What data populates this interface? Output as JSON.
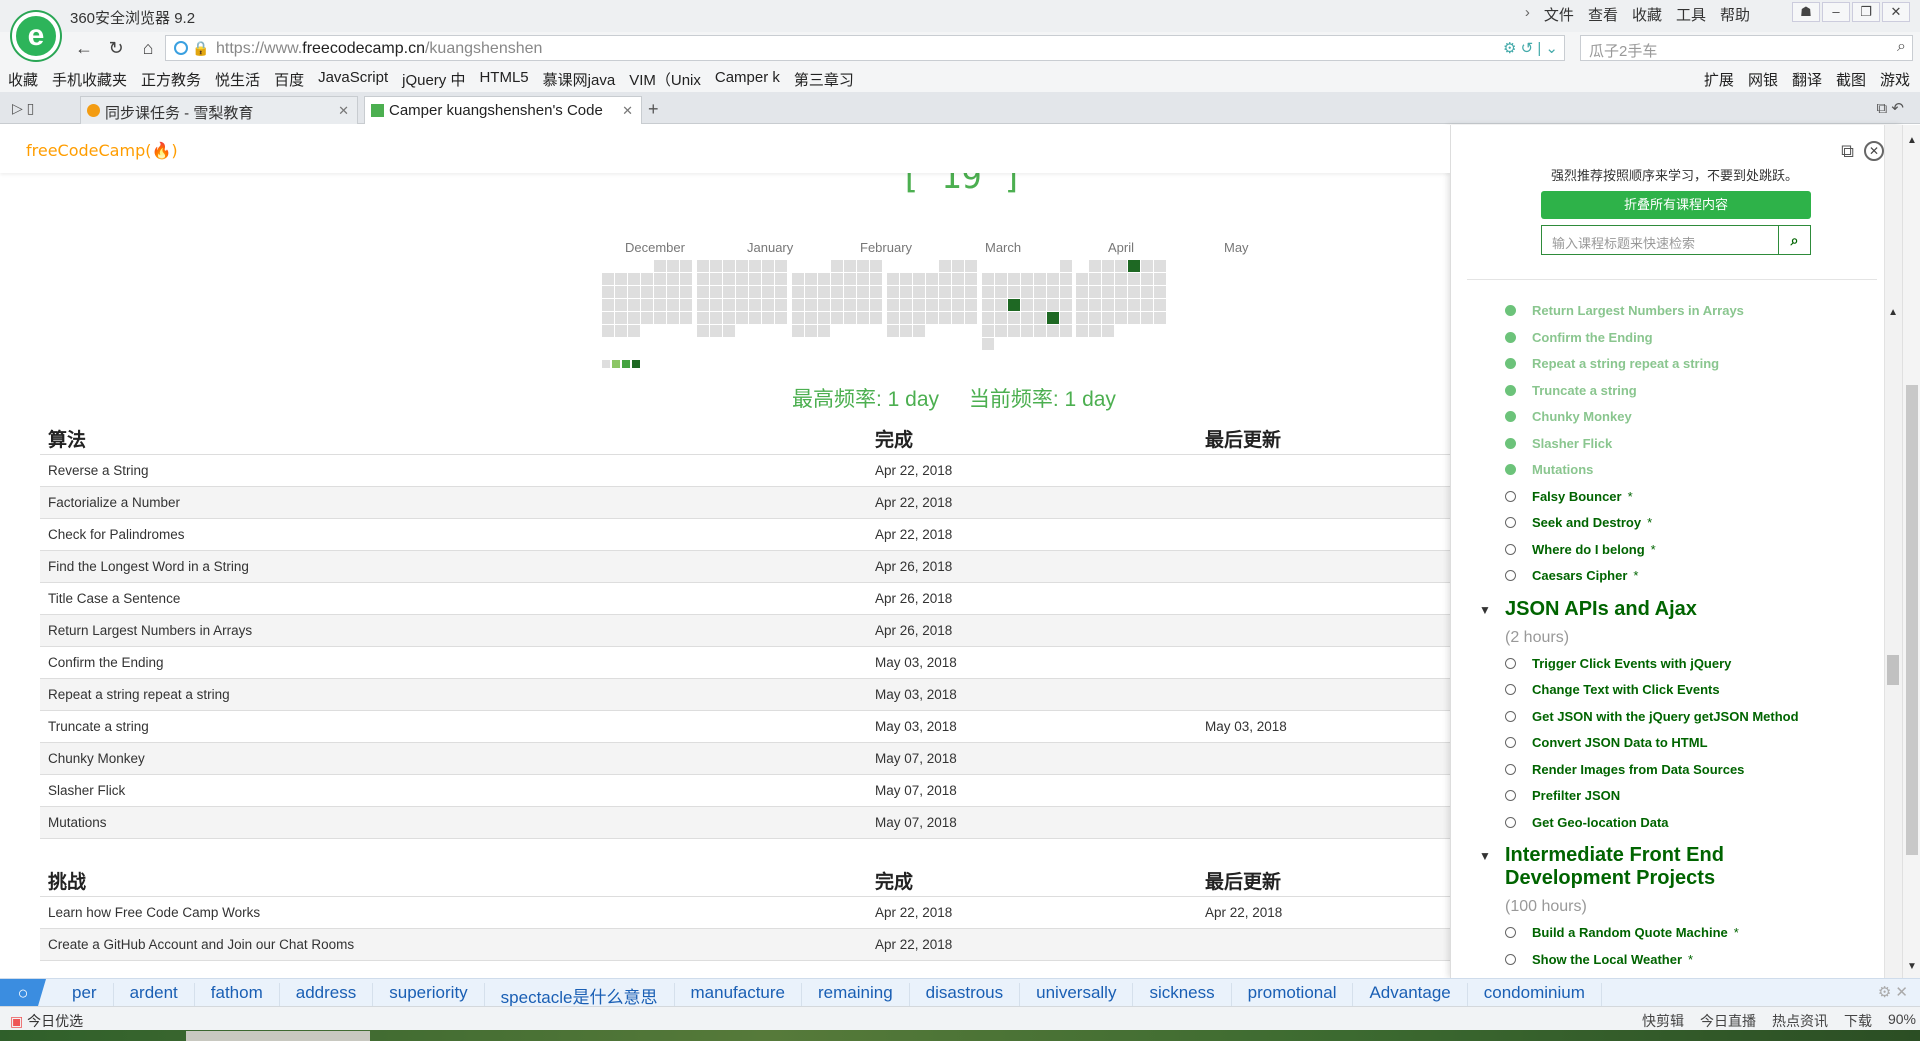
{
  "browser": {
    "app_title": "360安全浏览器 9.2",
    "menu": [
      "文件",
      "查看",
      "收藏",
      "工具",
      "帮助"
    ],
    "url_prefix": "https://www.",
    "url_domain": "freecodecamp.cn",
    "url_path": "/kuangshenshen",
    "search_placeholder": "瓜子2手车",
    "bookmarks": [
      "收藏",
      "手机收藏夹",
      "正方教务",
      "悦生活",
      "百度",
      "JavaScript",
      "jQuery 中",
      "HTML5",
      "慕课网java",
      "VIM（Unix",
      "Camper k",
      "第三章习"
    ],
    "bookmarks_right": [
      "扩展",
      "网银",
      "翻译",
      "截图",
      "游戏"
    ],
    "tabs": [
      {
        "label": "同步课任务 - 雪梨教育"
      },
      {
        "label": "Camper kuangshenshen's Code"
      }
    ]
  },
  "page": {
    "logo": "freeCodeCamp(🔥)",
    "streak_count": "[ 19 ]",
    "months": [
      "December",
      "January",
      "February",
      "March",
      "April",
      "May"
    ],
    "longest_streak": "最高频率: 1 day",
    "current_streak": "当前频率: 1 day",
    "algorithms": {
      "headers": [
        "算法",
        "完成",
        "最后更新"
      ],
      "rows": [
        [
          "Reverse a String",
          "Apr 22, 2018",
          ""
        ],
        [
          "Factorialize a Number",
          "Apr 22, 2018",
          ""
        ],
        [
          "Check for Palindromes",
          "Apr 22, 2018",
          ""
        ],
        [
          "Find the Longest Word in a String",
          "Apr 26, 2018",
          ""
        ],
        [
          "Title Case a Sentence",
          "Apr 26, 2018",
          ""
        ],
        [
          "Return Largest Numbers in Arrays",
          "Apr 26, 2018",
          ""
        ],
        [
          "Confirm the Ending",
          "May 03, 2018",
          ""
        ],
        [
          "Repeat a string repeat a string",
          "May 03, 2018",
          ""
        ],
        [
          "Truncate a string",
          "May 03, 2018",
          "May 03, 2018"
        ],
        [
          "Chunky Monkey",
          "May 07, 2018",
          ""
        ],
        [
          "Slasher Flick",
          "May 07, 2018",
          ""
        ],
        [
          "Mutations",
          "May 07, 2018",
          ""
        ]
      ]
    },
    "challenges": {
      "headers": [
        "挑战",
        "完成",
        "最后更新"
      ],
      "rows": [
        [
          "Learn how Free Code Camp Works",
          "Apr 22, 2018",
          "Apr 22, 2018"
        ],
        [
          "Create a GitHub Account and Join our Chat Rooms",
          "Apr 22, 2018",
          ""
        ]
      ]
    }
  },
  "side_panel": {
    "hint": "强烈推荐按照顺序来学习，不要到处跳跃。",
    "collapse_button": "折叠所有课程内容",
    "search_placeholder": "输入课程标题来快速检索",
    "algo_items": [
      {
        "title": "Return Largest Numbers in Arrays",
        "done": true
      },
      {
        "title": "Confirm the Ending",
        "done": true
      },
      {
        "title": "Repeat a string repeat a string",
        "done": true
      },
      {
        "title": "Truncate a string",
        "done": true
      },
      {
        "title": "Chunky Monkey",
        "done": true
      },
      {
        "title": "Slasher Flick",
        "done": true
      },
      {
        "title": "Mutations",
        "done": true
      },
      {
        "title": "Falsy Bouncer",
        "done": false,
        "star": "*"
      },
      {
        "title": "Seek and Destroy",
        "done": false,
        "star": "*"
      },
      {
        "title": "Where do I belong",
        "done": false,
        "star": "*"
      },
      {
        "title": "Caesars Cipher",
        "done": false,
        "star": "*"
      }
    ],
    "json_section": {
      "title": "JSON APIs and Ajax",
      "hours": "(2 hours)",
      "items": [
        "Trigger Click Events with jQuery",
        "Change Text with Click Events",
        "Get JSON with the jQuery getJSON Method",
        "Convert JSON Data to HTML",
        "Render Images from Data Sources",
        "Prefilter JSON",
        "Get Geo-location Data"
      ]
    },
    "project_section": {
      "title": "Intermediate Front End Development Projects",
      "hours": "(100 hours)",
      "items": [
        {
          "title": "Build a Random Quote Machine",
          "star": "*"
        },
        {
          "title": "Show the Local Weather",
          "star": "*"
        }
      ]
    }
  },
  "word_bar": {
    "words": [
      "per",
      "ardent",
      "fathom",
      "address",
      "superiority",
      "spectacle是什么意思",
      "manufacture",
      "remaining",
      "disastrous",
      "universally",
      "sickness",
      "promotional",
      "Advantage",
      "condominium"
    ]
  },
  "status_bar": {
    "left": "今日优选",
    "items": [
      "快剪辑",
      "今日直播",
      "热点资讯",
      "下载",
      "90%"
    ]
  },
  "colors": {
    "fcc_green": "#006400",
    "streak_green": "#4caf50",
    "done_green": "#8ac68f",
    "heat_on": "#1e6823",
    "heat_off": "#dedede"
  }
}
